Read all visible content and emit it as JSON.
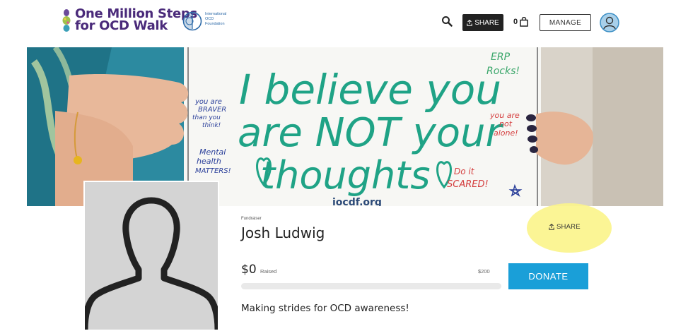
{
  "header": {
    "logo_title_line1": "One Million Steps",
    "logo_title_line2": "for OCD Walk",
    "partner_text_line1": "International",
    "partner_text_line2": "OCD",
    "partner_text_line3": "Foundation",
    "share_label": "SHARE",
    "cart_count": "0",
    "manage_label": "MANAGE"
  },
  "banner": {
    "line1": "I believe you",
    "line2": "are NOT your",
    "line3": "thoughts",
    "note_brave": [
      "you are",
      "BRAVER",
      "than you",
      "think!"
    ],
    "note_mental": [
      "Mental",
      "health",
      "MATTERS!"
    ],
    "note_erp": [
      "ERP",
      "Rocks!"
    ],
    "note_alone": [
      "you are",
      "not",
      "alone!"
    ],
    "note_scared": [
      "Do it",
      "SCARED!"
    ],
    "bottom_text": "iocdf.org"
  },
  "fundraiser": {
    "label": "Fundraiser",
    "name": "Josh Ludwig",
    "share_label": "SHARE",
    "raised_amount": "$0",
    "raised_label": "Raised",
    "goal": "$200",
    "progress_fraction": 0,
    "donate_label": "DONATE",
    "tagline": "Making strides for OCD awareness!"
  },
  "colors": {
    "brand_purple": "#4a2a7a",
    "accent_blue": "#1a9fd8",
    "highlight_yellow": "#fbf48a",
    "marker_green": "#1fa386"
  }
}
